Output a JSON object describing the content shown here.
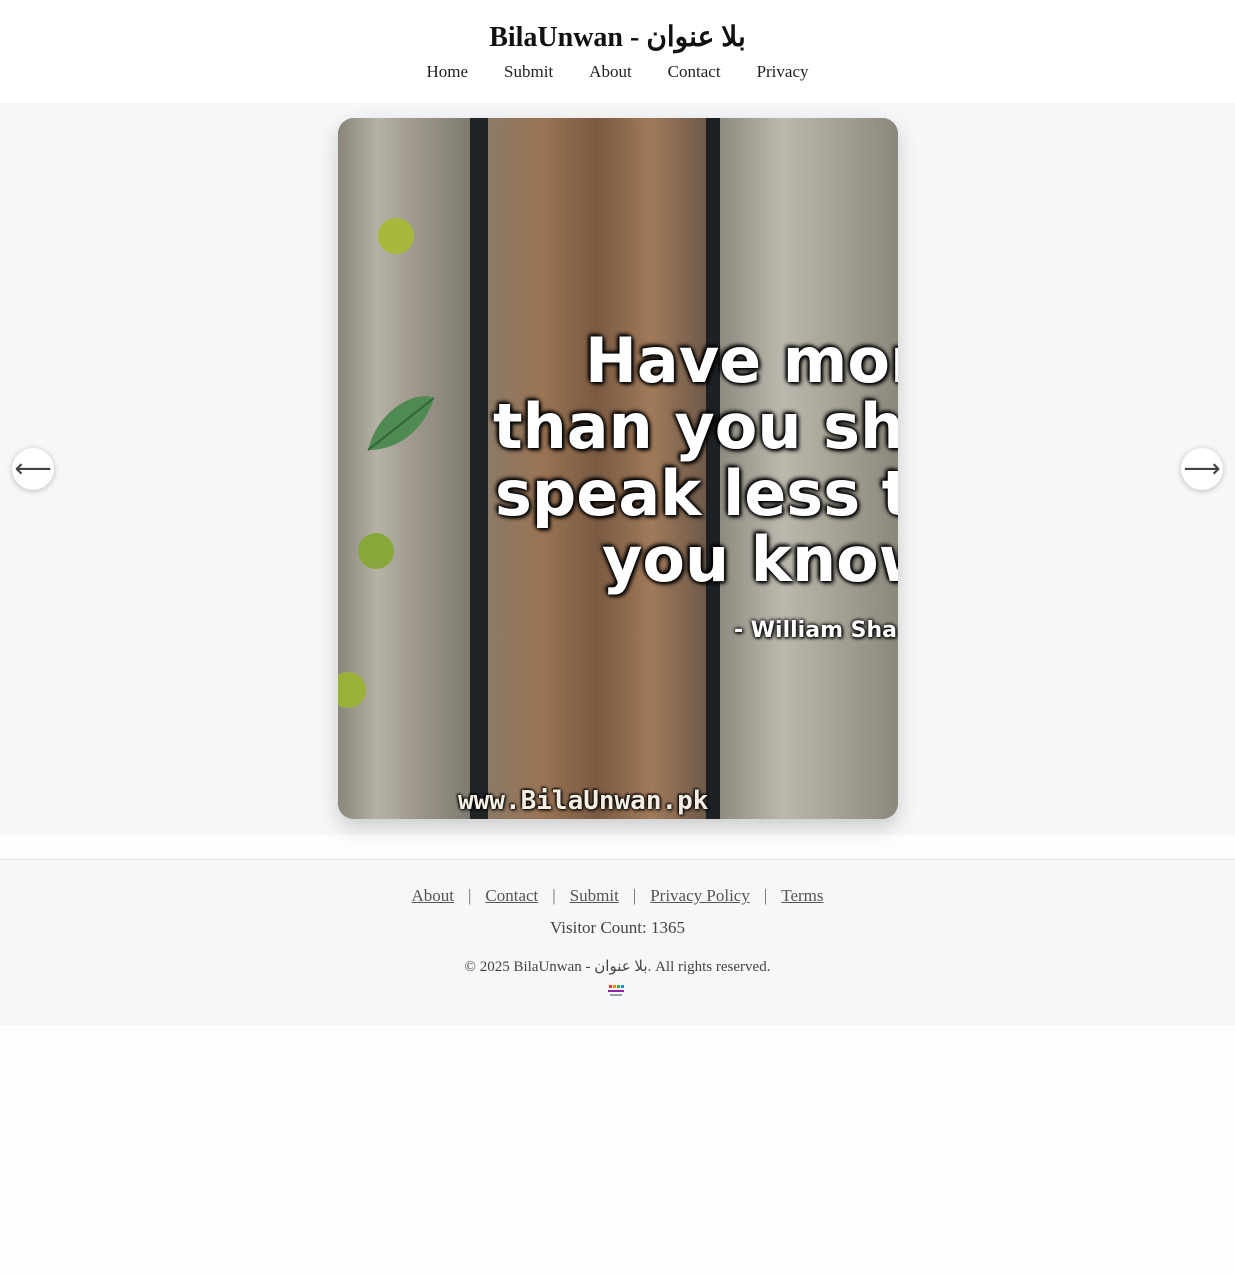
{
  "header": {
    "title": "BilaUnwan - بلا عنوان",
    "nav": [
      "Home",
      "Submit",
      "About",
      "Contact",
      "Privacy"
    ]
  },
  "slider": {
    "prev_icon": "arrow-left-icon",
    "next_icon": "arrow-right-icon",
    "image": {
      "quote_lines": [
        "Have mor",
        "than you sh",
        "speak less t",
        "you know"
      ],
      "author": "- William Sha",
      "watermark": "www.BilaUnwan.pk"
    }
  },
  "footer": {
    "links": [
      "About",
      "Contact",
      "Submit",
      "Privacy Policy",
      "Terms"
    ],
    "separator": "|",
    "visitor_count_label": "Visitor Count: 1365",
    "copyright": "© 2025 BilaUnwan - بلا عنوان. All rights reserved.",
    "badge_icon": "site-logo-icon"
  },
  "colors": {
    "main_background": "#f6f7f8",
    "header_background": "#ffffff",
    "link_color": "#555555"
  }
}
